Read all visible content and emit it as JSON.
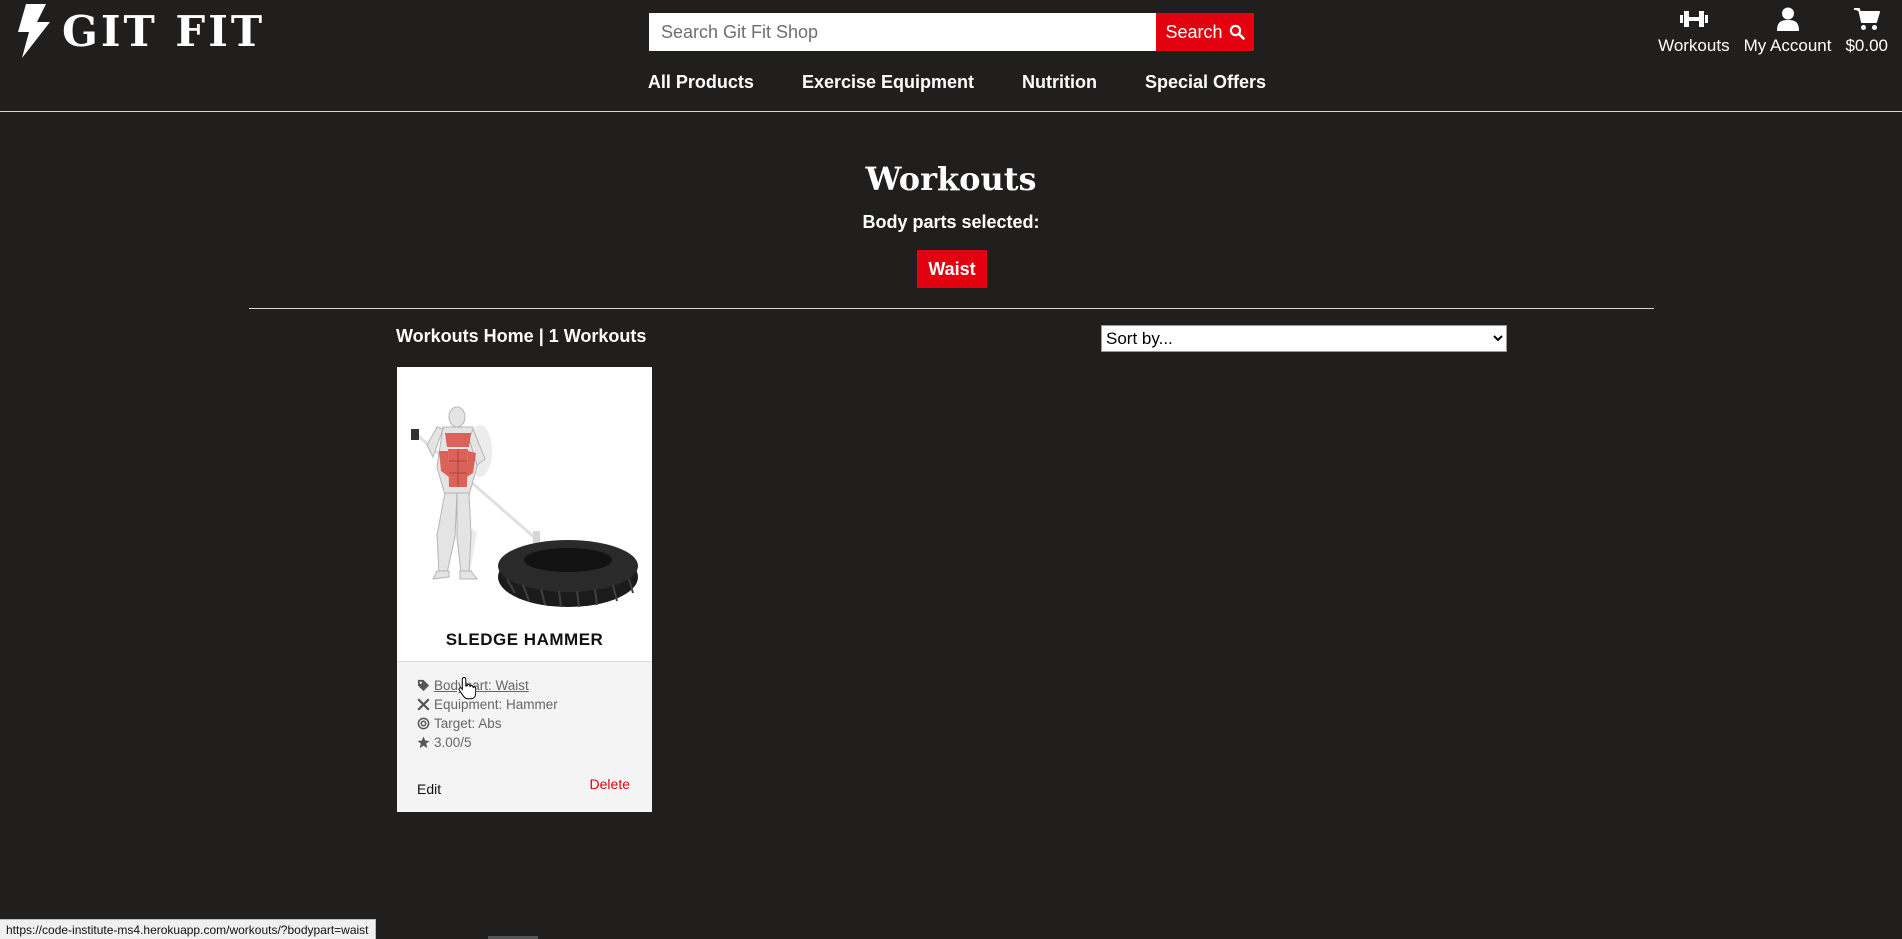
{
  "brand": {
    "name": "GIT FIT"
  },
  "search": {
    "placeholder": "Search Git Fit Shop",
    "button_label": "Search"
  },
  "header_links": [
    {
      "label": "Workouts",
      "icon": "dumbbell-icon"
    },
    {
      "label": "My Account",
      "icon": "user-icon"
    },
    {
      "label": "$0.00",
      "icon": "cart-icon"
    }
  ],
  "nav": [
    "All Products",
    "Exercise Equipment",
    "Nutrition",
    "Special Offers"
  ],
  "page": {
    "title": "Workouts",
    "bodyparts_label": "Body parts selected:",
    "selected_bodypart": "Waist",
    "home_link": "Workouts Home",
    "separator": " | ",
    "count_text": "1 Workouts",
    "sort_placeholder": "Sort by..."
  },
  "workouts": [
    {
      "title": "SLEDGE HAMMER",
      "bodypart": "Bodypart: Waist",
      "equipment": "Equipment: Hammer",
      "target": "Target: Abs",
      "rating": "3.00/5",
      "edit_label": "Edit",
      "delete_label": "Delete"
    }
  ],
  "statusbar": {
    "url": "https://code-institute-ms4.herokuapp.com/workouts/?bodypart=waist"
  },
  "colors": {
    "background": "#211f1e",
    "accent": "#e3000f",
    "card": "#ffffff",
    "card_body": "#f4f4f4"
  }
}
